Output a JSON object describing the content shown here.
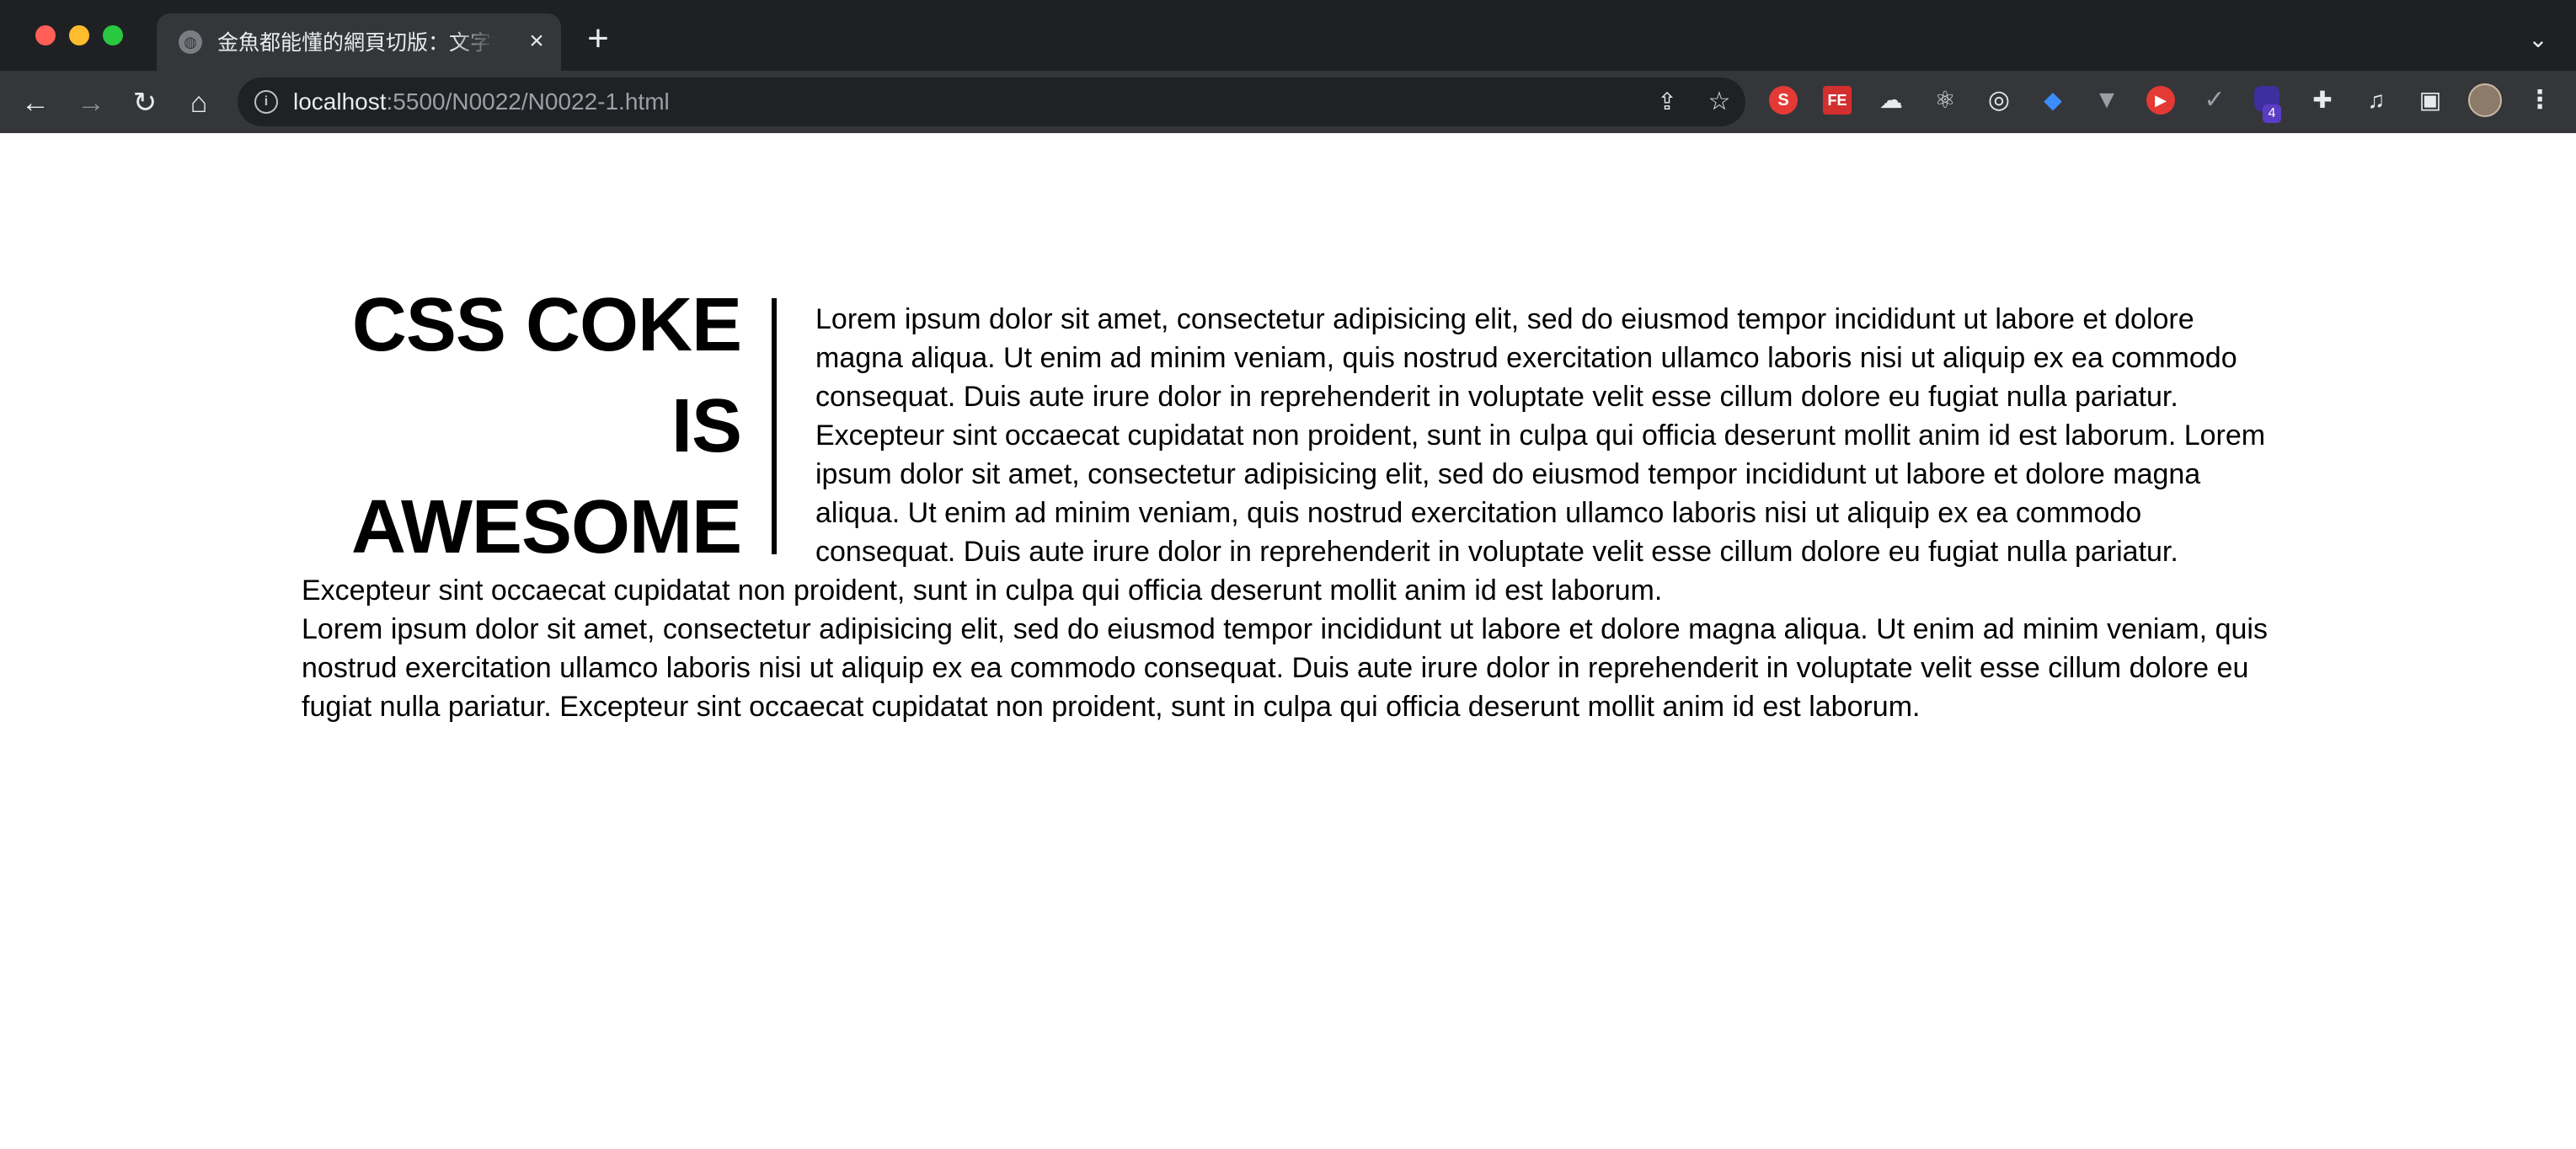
{
  "browser": {
    "tab_title": "金魚都能懂的網頁切版：文字排版",
    "url_host": "localhost",
    "url_path": ":5500/N0022/N0022-1.html",
    "extension_badge": "4",
    "toolbar_icons": [
      "back-icon",
      "forward-icon",
      "reload-icon",
      "home-icon",
      "info-icon",
      "share-icon",
      "star-icon"
    ],
    "extensions": [
      "s-extension",
      "fe-extension",
      "cloud-extension",
      "react-devtools",
      "target-extension",
      "gem-extension",
      "vue-devtools",
      "play-extension",
      "check-extension",
      "stack-extension",
      "puzzle-icon",
      "media-icon",
      "sidepanel-icon",
      "profile-avatar",
      "more-icon"
    ]
  },
  "page": {
    "heading": "CSS COKE IS AWESOME",
    "paragraph_1": "Lorem ipsum dolor sit amet, consectetur adipisicing elit, sed do eiusmod tempor incididunt ut labore et dolore magna aliqua. Ut enim ad minim veniam, quis nostrud exercitation ullamco laboris nisi ut aliquip ex ea commodo consequat. Duis aute irure dolor in reprehenderit in voluptate velit esse cillum dolore eu fugiat nulla pariatur. Excepteur sint occaecat cupidatat non proident, sunt in culpa qui officia deserunt mollit anim id est laborum. Lorem ipsum dolor sit amet, consectetur adipisicing elit, sed do eiusmod tempor incididunt ut labore et dolore magna aliqua. Ut enim ad minim veniam, quis nostrud exercitation ullamco laboris nisi ut aliquip ex ea commodo consequat. Duis aute irure dolor in reprehenderit in voluptate velit esse cillum dolore eu fugiat nulla pariatur. Excepteur sint occaecat cupidatat non proident, sunt in culpa qui officia deserunt mollit anim id est laborum.",
    "paragraph_2": "Lorem ipsum dolor sit amet, consectetur adipisicing elit, sed do eiusmod tempor incididunt ut labore et dolore magna aliqua. Ut enim ad minim veniam, quis nostrud exercitation ullamco laboris nisi ut aliquip ex ea commodo consequat. Duis aute irure dolor in reprehenderit in voluptate velit esse cillum dolore eu fugiat nulla pariatur. Excepteur sint occaecat cupidatat non proident, sunt in culpa qui officia deserunt mollit anim id est laborum."
  },
  "colors": {
    "chrome_dark": "#202124",
    "toolbar": "#35363a",
    "text": "#000000",
    "page_bg": "#ffffff"
  }
}
